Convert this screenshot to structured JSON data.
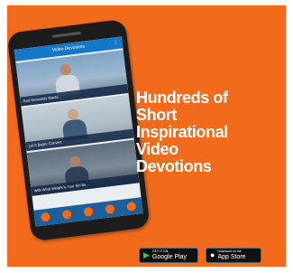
{
  "app": {
    "header_title": "Video Devotions",
    "menu_icon": "more-vertical-icon",
    "videos": [
      {
        "caption": "God Genuinely Wants..."
      },
      {
        "caption": "Let It Begin: Convert"
      },
      {
        "caption": "With What Weight is Your Sin Be..."
      }
    ],
    "nav_icons": [
      "home-icon",
      "bookmark-icon",
      "share-icon",
      "info-icon",
      "settings-icon"
    ]
  },
  "headline": {
    "line1": "Hundreds of",
    "line2": "Short",
    "line3": "Inspirational",
    "line4": "Video",
    "line5": "Devotions"
  },
  "badges": {
    "google_play": {
      "small": "GET IT ON",
      "big": "Google Play"
    },
    "app_store": {
      "small": "Download on the",
      "big": "App Store"
    }
  },
  "colors": {
    "background": "#f26a1b",
    "app_header": "#1577c8",
    "nav_bar": "#1d5f98"
  }
}
